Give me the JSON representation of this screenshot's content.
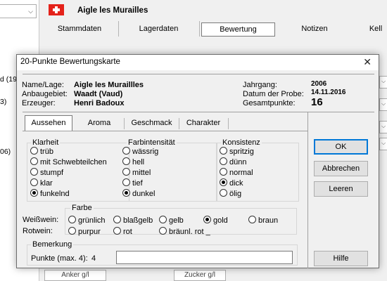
{
  "background": {
    "left_items": [
      "d (19",
      "3)",
      "06)"
    ],
    "title": "Aigle les Murailles",
    "tabs": [
      "Stammdaten",
      "Lagerdaten",
      "Bewertung",
      "Notizen",
      "Kell"
    ],
    "bottom_fields": [
      "Anker g/l",
      "Zucker g/l"
    ]
  },
  "dialog": {
    "title": "20-Punkte Bewertungskarte",
    "close_glyph": "✕",
    "info": {
      "name_label": "Name/Lage:",
      "name_value": "Aigle les Muraillles",
      "region_label": "Anbaugebiet:",
      "region_value": "Waadt (Vaud)",
      "producer_label": "Erzeuger:",
      "producer_value": "Henri Badoux",
      "vintage_label": "Jahrgang:",
      "vintage_value": "2006",
      "date_label": "Datum der Probe:",
      "date_value": "14.11.2016",
      "total_label": "Gesamtpunkte:",
      "total_value": "16"
    },
    "tabs": [
      "Aussehen",
      "Aroma",
      "Geschmack",
      "Charakter"
    ],
    "klarheit": {
      "label": "Klarheit",
      "options": [
        "trüb",
        "mit Schwebteilchen",
        "stumpf",
        "klar",
        "funkelnd"
      ],
      "selected": 4
    },
    "farbintensitaet": {
      "label": "Farbintensität",
      "options": [
        "wässrig",
        "hell",
        "mittel",
        "tief",
        "dunkel"
      ],
      "selected": 4
    },
    "konsistenz": {
      "label": "Konsistenz",
      "options": [
        "spritzig",
        "dünn",
        "normal",
        "dick",
        "ölig"
      ],
      "selected": 3
    },
    "farbe": {
      "label": "Farbe",
      "weiss_label": "Weißwein:",
      "weiss_options": [
        "grünlich",
        "blaßgelb",
        "gelb",
        "gold",
        "braun"
      ],
      "rot_label": "Rotwein:",
      "rot_options": [
        "purpur",
        "rot",
        "bräunl. rot _"
      ],
      "selected": "gold"
    },
    "bemerkung": {
      "label": "Bemerkung",
      "points_label": "Punkte (max. 4):",
      "points_value": "4",
      "text_value": ""
    },
    "buttons": {
      "ok": "OK",
      "cancel": "Abbrechen",
      "clear": "Leeren",
      "help": "Hilfe"
    }
  }
}
